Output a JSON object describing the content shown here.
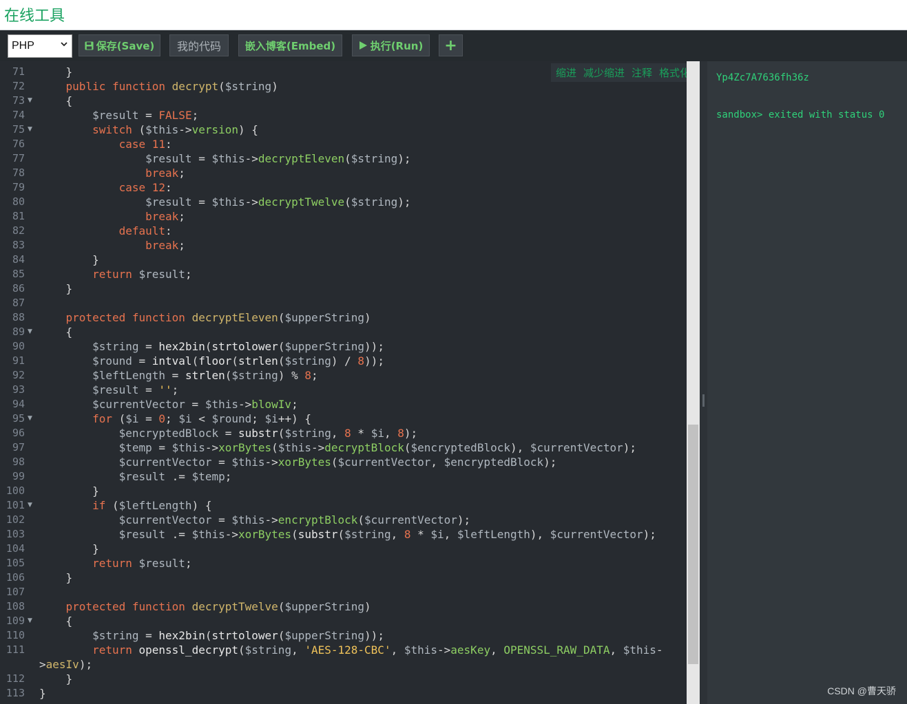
{
  "site_title": "在线工具",
  "toolbar": {
    "language": "PHP",
    "save_label": "保存(Save)",
    "mycode_label": "我的代码",
    "embed_label": "嵌入博客(Embed)",
    "run_label": "执行(Run)",
    "add_label": "+"
  },
  "editor": {
    "actions": [
      "缩进",
      "减少缩进",
      "注释",
      "格式化"
    ],
    "lines": [
      {
        "n": "71",
        "fold": false,
        "code": "    }"
      },
      {
        "n": "72",
        "fold": false,
        "code": "    public function decrypt($string)"
      },
      {
        "n": "73",
        "fold": true,
        "code": "    {"
      },
      {
        "n": "74",
        "fold": false,
        "code": "        $result = FALSE;"
      },
      {
        "n": "75",
        "fold": true,
        "code": "        switch ($this->version) {"
      },
      {
        "n": "76",
        "fold": false,
        "code": "            case 11:"
      },
      {
        "n": "77",
        "fold": false,
        "code": "                $result = $this->decryptEleven($string);"
      },
      {
        "n": "78",
        "fold": false,
        "code": "                break;"
      },
      {
        "n": "79",
        "fold": false,
        "code": "            case 12:"
      },
      {
        "n": "80",
        "fold": false,
        "code": "                $result = $this->decryptTwelve($string);"
      },
      {
        "n": "81",
        "fold": false,
        "code": "                break;"
      },
      {
        "n": "82",
        "fold": false,
        "code": "            default:"
      },
      {
        "n": "83",
        "fold": false,
        "code": "                break;"
      },
      {
        "n": "84",
        "fold": false,
        "code": "        }"
      },
      {
        "n": "85",
        "fold": false,
        "code": "        return $result;"
      },
      {
        "n": "86",
        "fold": false,
        "code": "    }"
      },
      {
        "n": "87",
        "fold": false,
        "code": ""
      },
      {
        "n": "88",
        "fold": false,
        "code": "    protected function decryptEleven($upperString)"
      },
      {
        "n": "89",
        "fold": true,
        "code": "    {"
      },
      {
        "n": "90",
        "fold": false,
        "code": "        $string = hex2bin(strtolower($upperString));"
      },
      {
        "n": "91",
        "fold": false,
        "code": "        $round = intval(floor(strlen($string) / 8));"
      },
      {
        "n": "92",
        "fold": false,
        "code": "        $leftLength = strlen($string) % 8;"
      },
      {
        "n": "93",
        "fold": false,
        "code": "        $result = '';"
      },
      {
        "n": "94",
        "fold": false,
        "code": "        $currentVector = $this->blowIv;"
      },
      {
        "n": "95",
        "fold": true,
        "code": "        for ($i = 0; $i < $round; $i++) {"
      },
      {
        "n": "96",
        "fold": false,
        "code": "            $encryptedBlock = substr($string, 8 * $i, 8);"
      },
      {
        "n": "97",
        "fold": false,
        "code": "            $temp = $this->xorBytes($this->decryptBlock($encryptedBlock), $currentVector);"
      },
      {
        "n": "98",
        "fold": false,
        "code": "            $currentVector = $this->xorBytes($currentVector, $encryptedBlock);"
      },
      {
        "n": "99",
        "fold": false,
        "code": "            $result .= $temp;"
      },
      {
        "n": "100",
        "fold": false,
        "code": "        }"
      },
      {
        "n": "101",
        "fold": true,
        "code": "        if ($leftLength) {"
      },
      {
        "n": "102",
        "fold": false,
        "code": "            $currentVector = $this->encryptBlock($currentVector);"
      },
      {
        "n": "103",
        "fold": false,
        "code": "            $result .= $this->xorBytes(substr($string, 8 * $i, $leftLength), $currentVector);"
      },
      {
        "n": "104",
        "fold": false,
        "code": "        }"
      },
      {
        "n": "105",
        "fold": false,
        "code": "        return $result;"
      },
      {
        "n": "106",
        "fold": false,
        "code": "    }"
      },
      {
        "n": "107",
        "fold": false,
        "code": ""
      },
      {
        "n": "108",
        "fold": false,
        "code": "    protected function decryptTwelve($upperString)"
      },
      {
        "n": "109",
        "fold": true,
        "code": "    {"
      },
      {
        "n": "110",
        "fold": false,
        "code": "        $string = hex2bin(strtolower($upperString));"
      },
      {
        "n": "111",
        "fold": false,
        "code": "        return openssl_decrypt($string, 'AES-128-CBC', $this->aesKey, OPENSSL_RAW_DATA, $this-"
      },
      {
        "n": "",
        "fold": false,
        "code": ">aesIv);"
      },
      {
        "n": "112",
        "fold": false,
        "code": "    }"
      },
      {
        "n": "113",
        "fold": false,
        "code": "}"
      }
    ]
  },
  "output": {
    "lines": [
      "Yp4Zc7A7636fh36z",
      "",
      "sandbox> exited with status 0"
    ]
  },
  "watermark": "CSDN @曹天骄",
  "colors": {
    "brand_green": "#1aa260",
    "editor_bg": "#272b30",
    "keyword": "#e8734f",
    "method": "#8ecf63",
    "string": "#f0c35a",
    "output_text": "#2fd27a"
  }
}
